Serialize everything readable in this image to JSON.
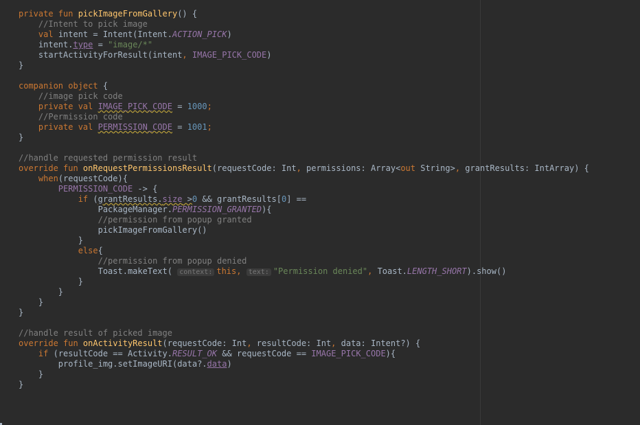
{
  "colors": {
    "background": "#2b2b2b",
    "keyword": "#cc7832",
    "function": "#ffc66d",
    "comment": "#808080",
    "number": "#6897bb",
    "string": "#6a8759",
    "constant": "#9876aa",
    "text": "#a9b7c6"
  },
  "lines": [
    [
      [
        "kw",
        "private fun "
      ],
      [
        "fn",
        "pickImageFromGallery"
      ],
      [
        "p",
        "() {"
      ]
    ],
    [
      [
        "p",
        "    "
      ],
      [
        "cm",
        "//Intent to pick image"
      ]
    ],
    [
      [
        "p",
        "    "
      ],
      [
        "kw",
        "val "
      ],
      [
        "p",
        "intent = Intent(Intent."
      ],
      [
        "const",
        "ACTION_PICK"
      ],
      [
        "p",
        ")"
      ]
    ],
    [
      [
        "p",
        "    intent."
      ],
      [
        "propi",
        "type"
      ],
      [
        "p",
        " = "
      ],
      [
        "str",
        "\"image/*\""
      ]
    ],
    [
      [
        "p",
        "    startActivityForResult(intent"
      ],
      [
        "kw",
        ", "
      ],
      [
        "pconst",
        "IMAGE_PICK_CODE"
      ],
      [
        "p",
        ")"
      ]
    ],
    [
      [
        "p",
        "}"
      ]
    ],
    [
      [
        "p",
        ""
      ]
    ],
    [
      [
        "kw",
        "companion object "
      ],
      [
        "p",
        "{"
      ]
    ],
    [
      [
        "p",
        "    "
      ],
      [
        "cm",
        "//image pick code"
      ]
    ],
    [
      [
        "p",
        "    "
      ],
      [
        "kw",
        "private val "
      ],
      [
        "pconstw",
        "IMAGE_PICK_CODE"
      ],
      [
        "p",
        " = "
      ],
      [
        "num",
        "1000"
      ],
      [
        "kw",
        ";"
      ]
    ],
    [
      [
        "p",
        "    "
      ],
      [
        "cm",
        "//Permission code"
      ]
    ],
    [
      [
        "p",
        "    "
      ],
      [
        "kw",
        "private val "
      ],
      [
        "pconstw",
        "PERMISSION_CODE"
      ],
      [
        "p",
        " = "
      ],
      [
        "num",
        "1001"
      ],
      [
        "kw",
        ";"
      ]
    ],
    [
      [
        "p",
        "}"
      ]
    ],
    [
      [
        "p",
        ""
      ]
    ],
    [
      [
        "cm",
        "//handle requested permission result"
      ]
    ],
    [
      [
        "kw",
        "override fun "
      ],
      [
        "fn",
        "onRequestPermissionsResult"
      ],
      [
        "p",
        "(requestCode: Int"
      ],
      [
        "kw",
        ", "
      ],
      [
        "p",
        "permissions: Array<"
      ],
      [
        "kw",
        "out "
      ],
      [
        "p",
        "String>"
      ],
      [
        "kw",
        ", "
      ],
      [
        "p",
        "grantResults: IntArray) {"
      ]
    ],
    [
      [
        "p",
        "    "
      ],
      [
        "kw",
        "when"
      ],
      [
        "p",
        "(requestCode){"
      ]
    ],
    [
      [
        "p",
        "        "
      ],
      [
        "pconst",
        "PERMISSION_CODE"
      ],
      [
        "p",
        " -> {"
      ]
    ],
    [
      [
        "p",
        "            "
      ],
      [
        "kw",
        "if "
      ],
      [
        "p",
        "("
      ],
      [
        "warnp",
        "grantResults."
      ],
      [
        "warnprop",
        "size"
      ],
      [
        "warnp",
        " >"
      ],
      [
        "num",
        "0"
      ],
      [
        "p",
        " && grantResults["
      ],
      [
        "num",
        "0"
      ],
      [
        "p",
        "] =="
      ]
    ],
    [
      [
        "p",
        "                PackageManager."
      ],
      [
        "const",
        "PERMISSION_GRANTED"
      ],
      [
        "p",
        "){"
      ]
    ],
    [
      [
        "p",
        "                "
      ],
      [
        "cm",
        "//permission from popup granted"
      ]
    ],
    [
      [
        "p",
        "                pickImageFromGallery()"
      ]
    ],
    [
      [
        "p",
        "            }"
      ]
    ],
    [
      [
        "p",
        "            "
      ],
      [
        "kw",
        "else"
      ],
      [
        "p",
        "{"
      ]
    ],
    [
      [
        "p",
        "                "
      ],
      [
        "cm",
        "//permission from popup denied"
      ]
    ],
    [
      [
        "p",
        "                Toast.makeText( "
      ],
      [
        "hint",
        "context:"
      ],
      [
        "kw",
        "this, "
      ],
      [
        "hint",
        "text:"
      ],
      [
        "str",
        "\"Permission denied\""
      ],
      [
        "kw",
        ", "
      ],
      [
        "p",
        "Toast."
      ],
      [
        "const",
        "LENGTH_SHORT"
      ],
      [
        "p",
        ").show()"
      ]
    ],
    [
      [
        "p",
        "            }"
      ]
    ],
    [
      [
        "p",
        "        }"
      ]
    ],
    [
      [
        "p",
        "    }"
      ]
    ],
    [
      [
        "p",
        "}"
      ]
    ],
    [
      [
        "p",
        ""
      ]
    ],
    [
      [
        "cm",
        "//handle result of picked image"
      ]
    ],
    [
      [
        "kw",
        "override fun "
      ],
      [
        "fn",
        "onActivityResult"
      ],
      [
        "p",
        "(requestCode: Int"
      ],
      [
        "kw",
        ", "
      ],
      [
        "p",
        "resultCode: Int"
      ],
      [
        "kw",
        ", "
      ],
      [
        "p",
        "data: Intent?) {"
      ]
    ],
    [
      [
        "p",
        "    "
      ],
      [
        "kw",
        "if "
      ],
      [
        "p",
        "(resultCode == Activity."
      ],
      [
        "const",
        "RESULT_OK"
      ],
      [
        "p",
        " && requestCode == "
      ],
      [
        "pconst",
        "IMAGE_PICK_CODE"
      ],
      [
        "p",
        "){"
      ]
    ],
    [
      [
        "p",
        "        profile_img.setImageURI(data?."
      ],
      [
        "propi",
        "data"
      ],
      [
        "p",
        ")"
      ]
    ],
    [
      [
        "p",
        "    }"
      ]
    ],
    [
      [
        "p",
        "}"
      ]
    ]
  ]
}
